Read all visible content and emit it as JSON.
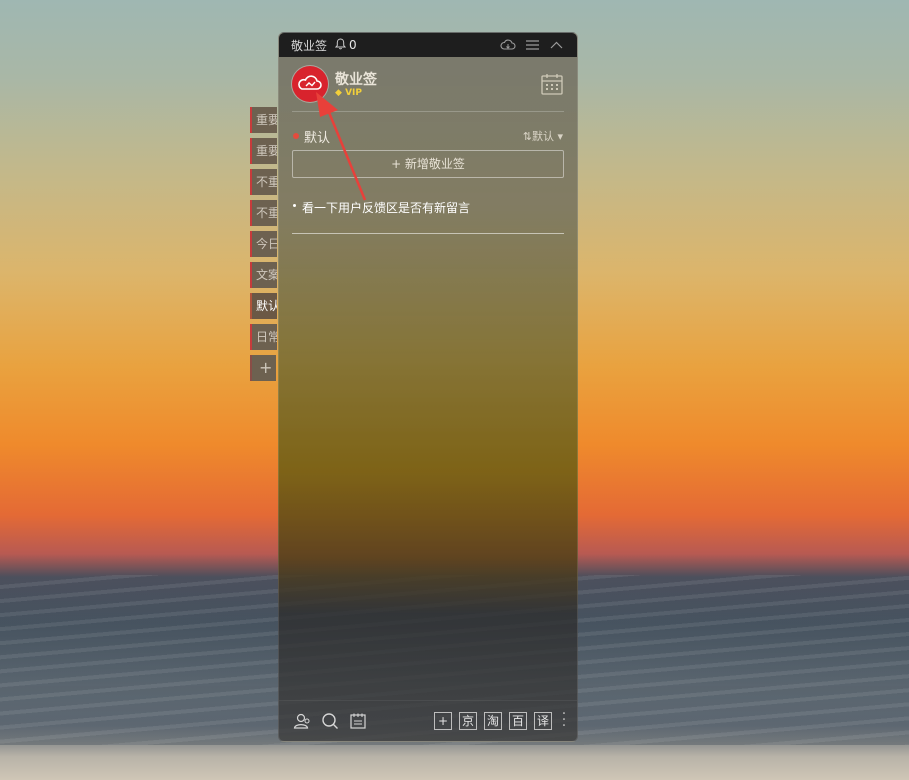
{
  "window": {
    "title": "敬业签",
    "reminder_count": "0"
  },
  "side_tabs": [
    {
      "label": "重要"
    },
    {
      "label": "重要"
    },
    {
      "label": "不重"
    },
    {
      "label": "不重"
    },
    {
      "label": "今日"
    },
    {
      "label": "文案"
    },
    {
      "label": "默认"
    },
    {
      "label": "日常"
    },
    {
      "label": "+"
    }
  ],
  "profile": {
    "app_name": "敬业签",
    "vip_badge": "VIP"
  },
  "category": {
    "name": "默认",
    "sort_label": "默认",
    "sort_icon": "⇅"
  },
  "add_note_button": "+ 新增敬业签",
  "notes": [
    {
      "text": "看一下用户反馈区是否有新留言"
    }
  ],
  "bottom_bar": {
    "quick_buttons": [
      "+",
      "京",
      "淘",
      "百",
      "译"
    ]
  },
  "colors": {
    "avatar": "#d8232d",
    "category_dot": "#e54b3d",
    "vip": "#f2cf3a",
    "annotation_arrow": "#e8403a"
  }
}
